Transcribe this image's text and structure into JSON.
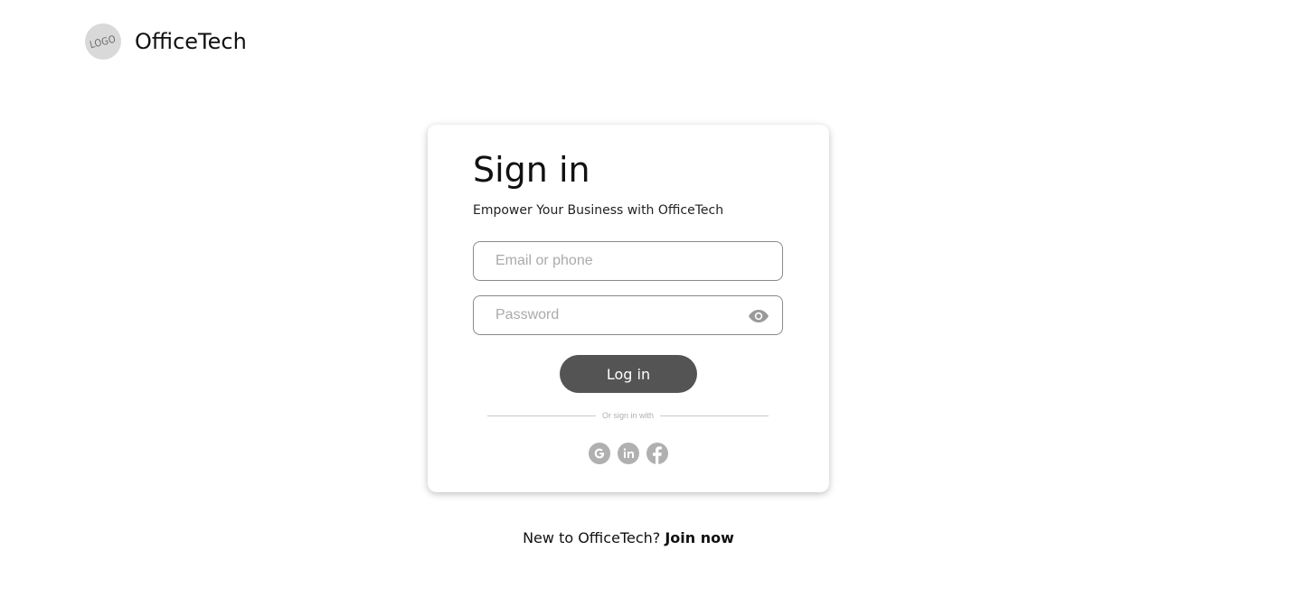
{
  "header": {
    "logo_text": "LOGO",
    "brand_name": "OfficeTech"
  },
  "card": {
    "title": "Sign in",
    "subtitle": "Empower Your Business with OfficeTech",
    "email_placeholder": "Email or phone",
    "password_placeholder": "Password",
    "login_label": "Log in",
    "divider_text": "Or sign in with",
    "social_icons": [
      "google-icon",
      "linkedin-icon",
      "facebook-icon"
    ]
  },
  "footer": {
    "prompt": "New to OfficeTech?",
    "join_label": "Join now"
  },
  "colors": {
    "button": "#545454",
    "icon_gray": "#b0b0b0"
  }
}
